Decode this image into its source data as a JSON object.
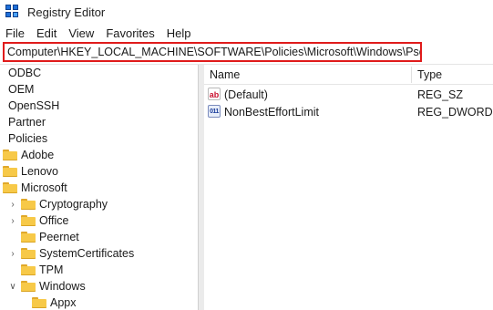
{
  "window": {
    "title": "Registry Editor"
  },
  "menu": [
    "File",
    "Edit",
    "View",
    "Favorites",
    "Help"
  ],
  "address": {
    "path": "Computer\\HKEY_LOCAL_MACHINE\\SOFTWARE\\Policies\\Microsoft\\Windows\\Psched"
  },
  "tree": [
    {
      "label": "ODBC",
      "level": 0,
      "folder": false,
      "expander": "none"
    },
    {
      "label": "OEM",
      "level": 0,
      "folder": false,
      "expander": "none"
    },
    {
      "label": "OpenSSH",
      "level": 0,
      "folder": false,
      "expander": "none"
    },
    {
      "label": "Partner",
      "level": 0,
      "folder": false,
      "expander": "none"
    },
    {
      "label": "Policies",
      "level": 0,
      "folder": false,
      "expander": "none"
    },
    {
      "label": "Adobe",
      "level": 1,
      "folder": true,
      "expander": "none"
    },
    {
      "label": "Lenovo",
      "level": 1,
      "folder": true,
      "expander": "none"
    },
    {
      "label": "Microsoft",
      "level": 1,
      "folder": true,
      "expander": "none"
    },
    {
      "label": "Cryptography",
      "level": 2,
      "folder": true,
      "expander": "collapsed"
    },
    {
      "label": "Office",
      "level": 2,
      "folder": true,
      "expander": "collapsed"
    },
    {
      "label": "Peernet",
      "level": 2,
      "folder": true,
      "expander": "none"
    },
    {
      "label": "SystemCertificates",
      "level": 2,
      "folder": true,
      "expander": "collapsed"
    },
    {
      "label": "TPM",
      "level": 2,
      "folder": true,
      "expander": "none"
    },
    {
      "label": "Windows",
      "level": 2,
      "folder": true,
      "expander": "expanded"
    },
    {
      "label": "Appx",
      "level": 3,
      "folder": true,
      "expander": "none"
    }
  ],
  "list": {
    "columns": {
      "name": "Name",
      "type": "Type"
    },
    "rows": [
      {
        "name": "(Default)",
        "type": "REG_SZ",
        "icon": "ab-string-icon",
        "glyph": "ab"
      },
      {
        "name": "NonBestEffortLimit",
        "type": "REG_DWORD",
        "icon": "binary-value-icon",
        "glyph": "011"
      }
    ]
  },
  "colors": {
    "highlight_border": "#e01b1b",
    "folder": "#f7c948"
  }
}
